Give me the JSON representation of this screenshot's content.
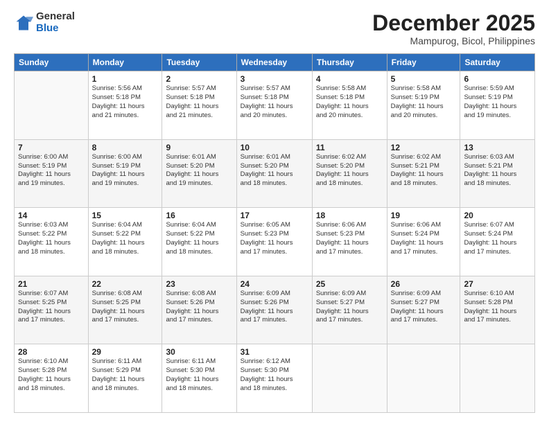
{
  "header": {
    "logo_general": "General",
    "logo_blue": "Blue",
    "month_title": "December 2025",
    "subtitle": "Mampurog, Bicol, Philippines"
  },
  "days_of_week": [
    "Sunday",
    "Monday",
    "Tuesday",
    "Wednesday",
    "Thursday",
    "Friday",
    "Saturday"
  ],
  "weeks": [
    [
      {
        "day": "",
        "info": ""
      },
      {
        "day": "1",
        "info": "Sunrise: 5:56 AM\nSunset: 5:18 PM\nDaylight: 11 hours\nand 21 minutes."
      },
      {
        "day": "2",
        "info": "Sunrise: 5:57 AM\nSunset: 5:18 PM\nDaylight: 11 hours\nand 21 minutes."
      },
      {
        "day": "3",
        "info": "Sunrise: 5:57 AM\nSunset: 5:18 PM\nDaylight: 11 hours\nand 20 minutes."
      },
      {
        "day": "4",
        "info": "Sunrise: 5:58 AM\nSunset: 5:18 PM\nDaylight: 11 hours\nand 20 minutes."
      },
      {
        "day": "5",
        "info": "Sunrise: 5:58 AM\nSunset: 5:19 PM\nDaylight: 11 hours\nand 20 minutes."
      },
      {
        "day": "6",
        "info": "Sunrise: 5:59 AM\nSunset: 5:19 PM\nDaylight: 11 hours\nand 19 minutes."
      }
    ],
    [
      {
        "day": "7",
        "info": "Sunrise: 6:00 AM\nSunset: 5:19 PM\nDaylight: 11 hours\nand 19 minutes."
      },
      {
        "day": "8",
        "info": "Sunrise: 6:00 AM\nSunset: 5:19 PM\nDaylight: 11 hours\nand 19 minutes."
      },
      {
        "day": "9",
        "info": "Sunrise: 6:01 AM\nSunset: 5:20 PM\nDaylight: 11 hours\nand 19 minutes."
      },
      {
        "day": "10",
        "info": "Sunrise: 6:01 AM\nSunset: 5:20 PM\nDaylight: 11 hours\nand 18 minutes."
      },
      {
        "day": "11",
        "info": "Sunrise: 6:02 AM\nSunset: 5:20 PM\nDaylight: 11 hours\nand 18 minutes."
      },
      {
        "day": "12",
        "info": "Sunrise: 6:02 AM\nSunset: 5:21 PM\nDaylight: 11 hours\nand 18 minutes."
      },
      {
        "day": "13",
        "info": "Sunrise: 6:03 AM\nSunset: 5:21 PM\nDaylight: 11 hours\nand 18 minutes."
      }
    ],
    [
      {
        "day": "14",
        "info": "Sunrise: 6:03 AM\nSunset: 5:22 PM\nDaylight: 11 hours\nand 18 minutes."
      },
      {
        "day": "15",
        "info": "Sunrise: 6:04 AM\nSunset: 5:22 PM\nDaylight: 11 hours\nand 18 minutes."
      },
      {
        "day": "16",
        "info": "Sunrise: 6:04 AM\nSunset: 5:22 PM\nDaylight: 11 hours\nand 18 minutes."
      },
      {
        "day": "17",
        "info": "Sunrise: 6:05 AM\nSunset: 5:23 PM\nDaylight: 11 hours\nand 17 minutes."
      },
      {
        "day": "18",
        "info": "Sunrise: 6:06 AM\nSunset: 5:23 PM\nDaylight: 11 hours\nand 17 minutes."
      },
      {
        "day": "19",
        "info": "Sunrise: 6:06 AM\nSunset: 5:24 PM\nDaylight: 11 hours\nand 17 minutes."
      },
      {
        "day": "20",
        "info": "Sunrise: 6:07 AM\nSunset: 5:24 PM\nDaylight: 11 hours\nand 17 minutes."
      }
    ],
    [
      {
        "day": "21",
        "info": "Sunrise: 6:07 AM\nSunset: 5:25 PM\nDaylight: 11 hours\nand 17 minutes."
      },
      {
        "day": "22",
        "info": "Sunrise: 6:08 AM\nSunset: 5:25 PM\nDaylight: 11 hours\nand 17 minutes."
      },
      {
        "day": "23",
        "info": "Sunrise: 6:08 AM\nSunset: 5:26 PM\nDaylight: 11 hours\nand 17 minutes."
      },
      {
        "day": "24",
        "info": "Sunrise: 6:09 AM\nSunset: 5:26 PM\nDaylight: 11 hours\nand 17 minutes."
      },
      {
        "day": "25",
        "info": "Sunrise: 6:09 AM\nSunset: 5:27 PM\nDaylight: 11 hours\nand 17 minutes."
      },
      {
        "day": "26",
        "info": "Sunrise: 6:09 AM\nSunset: 5:27 PM\nDaylight: 11 hours\nand 17 minutes."
      },
      {
        "day": "27",
        "info": "Sunrise: 6:10 AM\nSunset: 5:28 PM\nDaylight: 11 hours\nand 17 minutes."
      }
    ],
    [
      {
        "day": "28",
        "info": "Sunrise: 6:10 AM\nSunset: 5:28 PM\nDaylight: 11 hours\nand 18 minutes."
      },
      {
        "day": "29",
        "info": "Sunrise: 6:11 AM\nSunset: 5:29 PM\nDaylight: 11 hours\nand 18 minutes."
      },
      {
        "day": "30",
        "info": "Sunrise: 6:11 AM\nSunset: 5:30 PM\nDaylight: 11 hours\nand 18 minutes."
      },
      {
        "day": "31",
        "info": "Sunrise: 6:12 AM\nSunset: 5:30 PM\nDaylight: 11 hours\nand 18 minutes."
      },
      {
        "day": "",
        "info": ""
      },
      {
        "day": "",
        "info": ""
      },
      {
        "day": "",
        "info": ""
      }
    ]
  ]
}
